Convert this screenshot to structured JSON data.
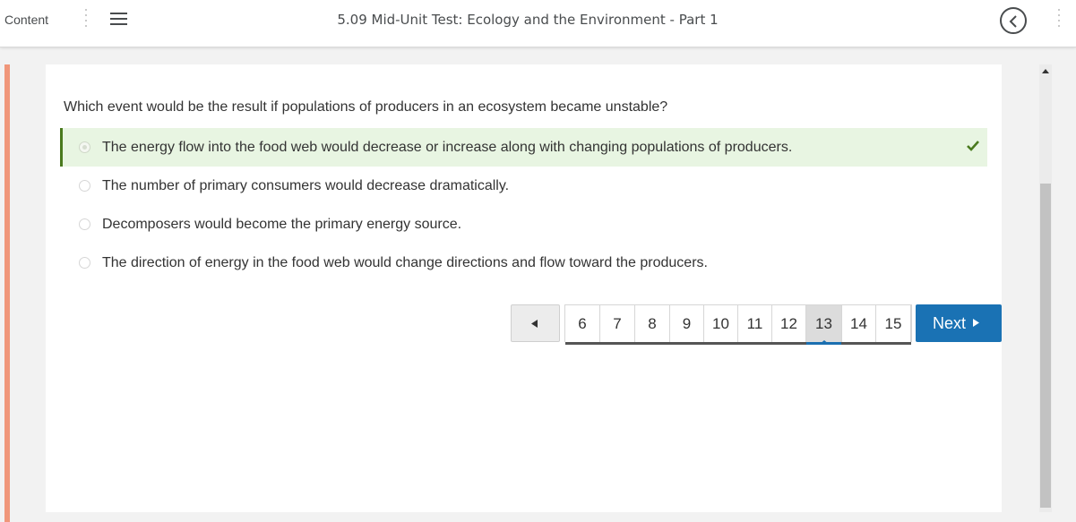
{
  "topbar": {
    "content_label": "Content",
    "title": "5.09 Mid-Unit Test: Ecology and the Environment - Part 1"
  },
  "question": {
    "text": "Which event would be the result if populations of producers in an ecosystem became unstable?",
    "options": [
      {
        "text": "The energy flow into the food web would decrease or increase along with changing populations of producers.",
        "selected": true,
        "correct": true
      },
      {
        "text": "The number of primary consumers would decrease dramatically.",
        "selected": false,
        "correct": false
      },
      {
        "text": "Decomposers would become the primary energy source.",
        "selected": false,
        "correct": false
      },
      {
        "text": "The direction of energy in the food web would change directions and flow toward the producers.",
        "selected": false,
        "correct": false
      }
    ]
  },
  "pagination": {
    "pages": [
      "6",
      "7",
      "8",
      "9",
      "10",
      "11",
      "12",
      "13",
      "14",
      "15"
    ],
    "current": "13",
    "next_label": "Next"
  },
  "colors": {
    "accent": "#f0967a",
    "correct_bg": "#e8f5e2",
    "correct_check": "#4a7a1e",
    "next_button": "#1a72b4"
  },
  "icons": {
    "menu": "hamburger-icon",
    "back": "chevron-left-circle-icon",
    "more": "vertical-dots-icon",
    "correct": "checkmark-icon",
    "prev": "triangle-left-icon",
    "next": "triangle-right-icon"
  }
}
